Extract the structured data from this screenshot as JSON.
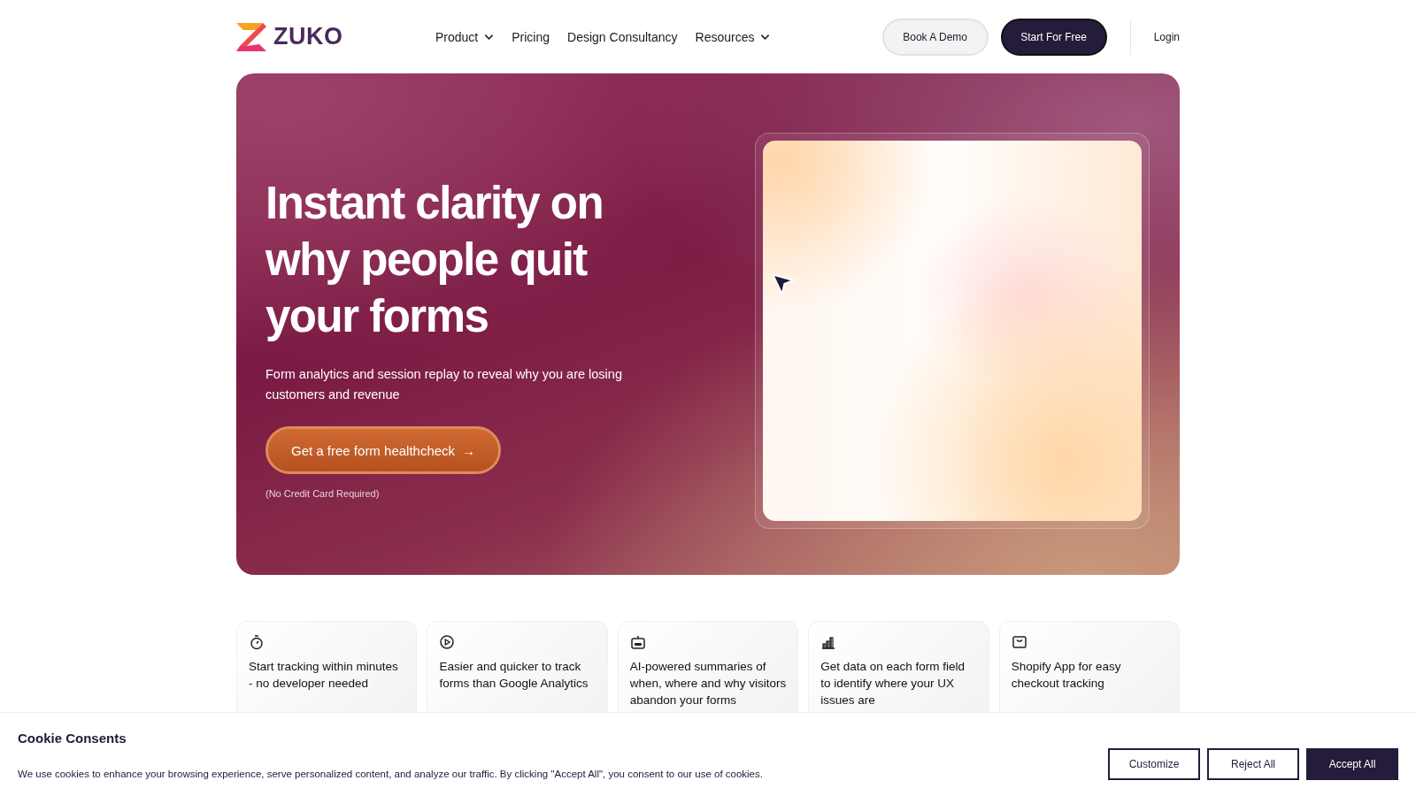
{
  "header": {
    "logo_text": "ZUKO",
    "nav": [
      {
        "label": "Product",
        "dropdown": true
      },
      {
        "label": "Pricing",
        "dropdown": false
      },
      {
        "label": "Design Consultancy",
        "dropdown": false
      },
      {
        "label": "Resources",
        "dropdown": true
      }
    ],
    "buttons": [
      {
        "label": "Book A Demo",
        "kind": "secondary"
      },
      {
        "label": "Start For Free",
        "kind": "primary"
      }
    ],
    "login": "Login"
  },
  "hero": {
    "headline": "Instant clarity on why people quit your forms",
    "subtitle": "Form analytics and session replay to reveal why you are losing customers and revenue",
    "cta": "Get a free form healthcheck",
    "cta_arrow": "→",
    "note": "(No Credit Card Required)"
  },
  "features": [
    {
      "kind": "stopwatch",
      "text": "Start tracking within minutes - no developer needed"
    },
    {
      "kind": "play",
      "text": "Easier and quicker to track forms than Google Analytics"
    },
    {
      "kind": "robot",
      "text": "AI-powered summaries of when, where and why visitors abandon your forms"
    },
    {
      "kind": "chart",
      "text": "Get data on each form field to identify where your UX issues are"
    },
    {
      "kind": "bag",
      "text": "Shopify App for easy checkout tracking"
    }
  ],
  "cookie_banner": {
    "title": "Cookie Consents",
    "text": "We use cookies to enhance your browsing experience, serve personalized content, and analyze our traffic. By clicking \"Accept All\", you consent to our use of cookies.",
    "buttons": [
      {
        "label": "Customize",
        "kind": "outline"
      },
      {
        "label": "Reject All",
        "kind": "outline"
      },
      {
        "label": "Accept All",
        "kind": "filled"
      }
    ]
  }
}
